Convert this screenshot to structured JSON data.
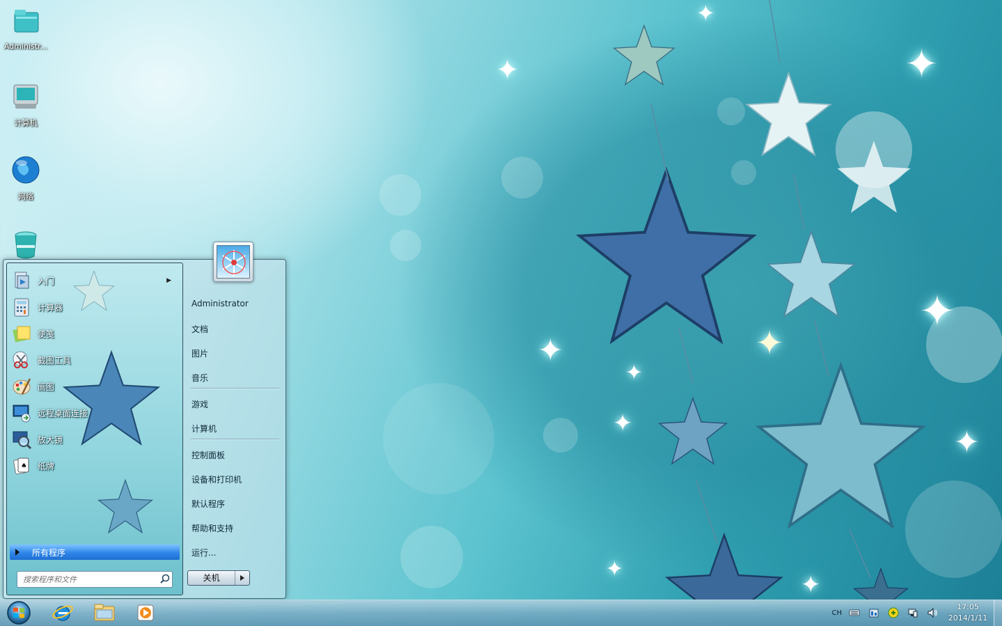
{
  "desktop": {
    "icons": [
      {
        "label": "Administr...",
        "icon": "user-folder-icon"
      },
      {
        "label": "计算机",
        "icon": "computer-icon"
      },
      {
        "label": "网络",
        "icon": "network-globe-icon"
      },
      {
        "label": "",
        "icon": "recycle-bin-icon"
      }
    ]
  },
  "start_menu": {
    "pinned_programs": [
      {
        "label": "入门",
        "icon": "getting-started-icon",
        "has_submenu": true
      },
      {
        "label": "计算器",
        "icon": "calculator-icon"
      },
      {
        "label": "便笺",
        "icon": "sticky-notes-icon"
      },
      {
        "label": "截图工具",
        "icon": "snipping-tool-icon"
      },
      {
        "label": "画图",
        "icon": "paint-icon"
      },
      {
        "label": "远程桌面连接",
        "icon": "remote-desktop-icon"
      },
      {
        "label": "放大镜",
        "icon": "magnifier-icon"
      },
      {
        "label": "纸牌",
        "icon": "solitaire-icon"
      }
    ],
    "all_programs_label": "所有程序",
    "search_placeholder": "搜索程序和文件",
    "right_items": {
      "user": "Administrator",
      "documents": "文档",
      "pictures": "图片",
      "music": "音乐",
      "games": "游戏",
      "computer": "计算机",
      "control_panel": "控制面板",
      "devices_printers": "设备和打印机",
      "default_programs": "默认程序",
      "help_support": "帮助和支持",
      "run": "运行..."
    },
    "shutdown_label": "关机"
  },
  "taskbar": {
    "pinned": [
      "internet-explorer-icon",
      "explorer-folder-icon",
      "media-player-icon"
    ],
    "language": "CH",
    "time": "17:05",
    "date": "2014/1/11",
    "accent_color": "#2e86e8"
  }
}
